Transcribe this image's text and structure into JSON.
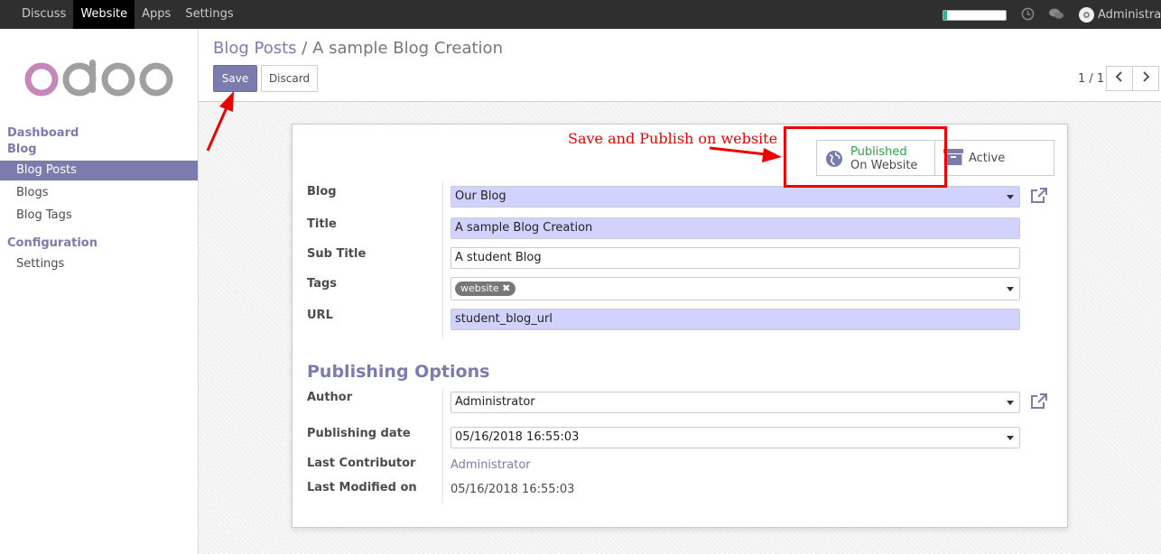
{
  "topbar": {
    "menu": [
      "Discuss",
      "Website",
      "Apps",
      "Settings"
    ],
    "active_menu": "Website",
    "user_name": "Administrator",
    "progress_fraction": 0.06,
    "accent_color": "#7c7bad"
  },
  "sidebar": {
    "sections": [
      {
        "label": "Dashboard"
      },
      {
        "label": "Blog",
        "items": [
          {
            "label": "Blog Posts",
            "active": true
          },
          {
            "label": "Blogs",
            "active": false
          },
          {
            "label": "Blog Tags",
            "active": false
          }
        ]
      },
      {
        "label": "Configuration",
        "items": [
          {
            "label": "Settings",
            "active": false
          }
        ]
      }
    ]
  },
  "control": {
    "breadcrumb_parent": "Blog Posts",
    "breadcrumb_sep": "/",
    "breadcrumb_current": "A sample Blog Creation",
    "save_label": "Save",
    "discard_label": "Discard",
    "pager": "1 / 1",
    "prev_icon": "chevron-left-icon",
    "next_icon": "chevron-right-icon"
  },
  "stat_buttons": {
    "publish_line1": "Published",
    "publish_line2": "On Website",
    "publish_icon": "globe-icon",
    "active_label": "Active",
    "active_icon": "archive-icon"
  },
  "form": {
    "blog_label": "Blog",
    "blog_value": "Our Blog",
    "title_label": "Title",
    "title_value": "A sample Blog Creation",
    "subtitle_label": "Sub Title",
    "subtitle_value": "A student Blog",
    "tags_label": "Tags",
    "tags": [
      "website"
    ],
    "url_label": "URL",
    "url_value": "student_blog_url",
    "publishing_title": "Publishing Options",
    "author_label": "Author",
    "author_value": "Administrator",
    "pubdate_label": "Publishing date",
    "pubdate_value": "05/16/2018 16:55:03",
    "contributor_label": "Last Contributor",
    "contributor_value": "Administrator",
    "modified_label": "Last Modified on",
    "modified_value": "05/16/2018 16:55:03"
  },
  "annotation": {
    "text": "Save and Publish on website",
    "color": "#e00000"
  }
}
